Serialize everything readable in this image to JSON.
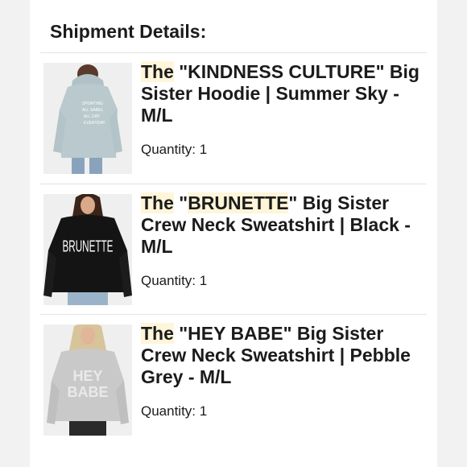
{
  "shipment": {
    "heading": "Shipment Details:",
    "quantity_label": "Quantity:",
    "items": [
      {
        "title_highlight": "The",
        "title_rest": " \"KINDNESS CULTURE\" Big Sister Hoodie | Summer Sky - M/L",
        "quantity": "1",
        "image_print": [
          "SPORTING",
          "ALL SABEL",
          "ALL DAY",
          "EVERYDAY"
        ],
        "garment_color": "#b9c9cd"
      },
      {
        "title_highlight": "The",
        "title_pre": " \"",
        "title_mid": "BRUNETTE",
        "title_post": "\" Big Sister Crew Neck Sweatshirt | Black - M/L",
        "quantity": "1",
        "image_print": "BRUNETTE",
        "garment_color": "#141414"
      },
      {
        "title_highlight": "The",
        "title_rest": " \"HEY BABE\" Big Sister Crew Neck Sweatshirt | Pebble Grey - M/L",
        "quantity": "1",
        "image_print": [
          "HEY",
          "BABE"
        ],
        "garment_color": "#c9c9c9"
      }
    ]
  },
  "colors": {
    "highlight": "#fff5d9",
    "divider": "#e4e4e4",
    "text": "#1b1b1b"
  }
}
